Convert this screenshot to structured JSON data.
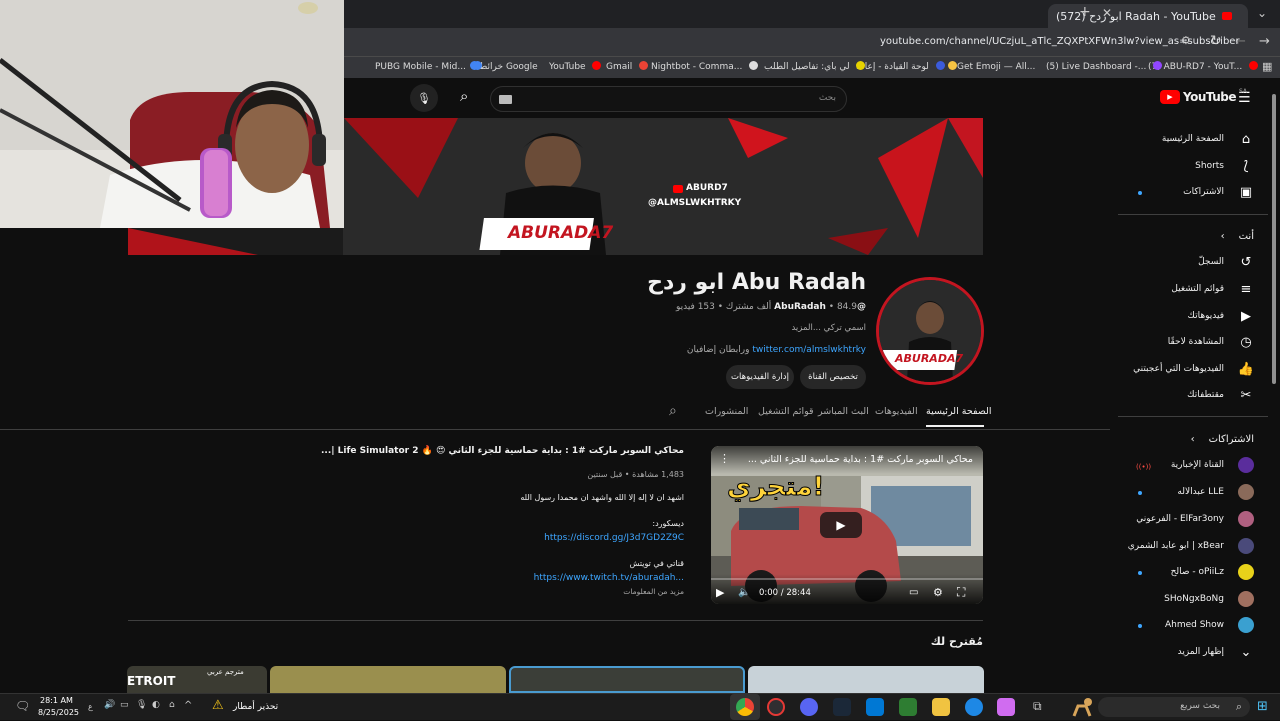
{
  "browser": {
    "tab_title": "(572) ابو ردح Radah - YouTube",
    "url": "youtube.com/channel/UCzjuL_aTlc_ZQXPtXFWn3lw?view_as=subscriber",
    "bookmarks": [
      {
        "label": "(7) ABU-RD7 - YouT...",
        "color": "#ff0000"
      },
      {
        "label": "(5) Live Dashboard -...",
        "color": "#9146ff"
      },
      {
        "label": "Get Emoji — All...",
        "color": "#f6c343"
      },
      {
        "label": "لوحة القيادة - إعادة",
        "color": "#3b5bdb"
      },
      {
        "label": "لي باي: تفاصيل الطلب",
        "color": "#e6d200"
      },
      {
        "label": "Nightbot - Comma...",
        "color": "#dddddd"
      },
      {
        "label": "Gmail",
        "color": "#ea4335"
      },
      {
        "label": "YouTube",
        "color": "#ff0000"
      },
      {
        "label": "خرائط Google",
        "color": "#34a853"
      },
      {
        "label": "PUBG Mobile - Mid...",
        "color": "#4285f4"
      }
    ]
  },
  "youtube": {
    "logo_text": "YouTube",
    "logo_region": "SA",
    "search_placeholder": "بحث"
  },
  "sidebar": {
    "main": [
      {
        "label": "الصفحة الرئيسية",
        "icon": "home-icon"
      },
      {
        "label": "Shorts",
        "icon": "shorts-icon"
      },
      {
        "label": "الاشتراكات",
        "icon": "subscriptions-icon"
      }
    ],
    "you_heading": "أنت",
    "you": [
      {
        "label": "السجلّ",
        "icon": "history-icon"
      },
      {
        "label": "قوائم التشغيل",
        "icon": "playlist-icon"
      },
      {
        "label": "فيديوهاتك",
        "icon": "your-videos-icon"
      },
      {
        "label": "المشاهدة لاحقًا",
        "icon": "watch-later-icon"
      },
      {
        "label": "الفيديوهات التي أعجبتني",
        "icon": "thumbs-up-icon"
      },
      {
        "label": "مقتطفاتك",
        "icon": "clips-icon"
      }
    ],
    "subs_heading": "الاشتراكات",
    "subs": [
      {
        "label": "القناة الإخبارية",
        "color": "#5a2d9c",
        "live": true
      },
      {
        "label": "LLE عبدالاله",
        "color": "#8a6a5a"
      },
      {
        "label": "ElFar3ony - الفرعوني",
        "color": "#b06080"
      },
      {
        "label": "xBear | ابو عابد الشمري",
        "color": "#4a4a7a"
      },
      {
        "label": "oPiiLz - صالح",
        "color": "#e8d21a"
      },
      {
        "label": "SHoNgxBoNg",
        "color": "#a07060"
      },
      {
        "label": "Ahmed Show",
        "color": "#3aa0d0"
      }
    ],
    "show_more": "إظهار المزيد"
  },
  "banner": {
    "handle_line1": "ABURD7",
    "handle_line2": "@ALMSLWKHTRKY",
    "logo": "ABURADA7"
  },
  "channel": {
    "name": "ابو ردح Abu Radah",
    "handle": "@AbuRadah",
    "stats": "84.9 ألف مشترك ‏• 153 فيديو",
    "about": "اسمي تركي ...المزيد",
    "link": "twitter.com/almslwkhtrky",
    "link_extra": "ورابطان إضافيان",
    "customize_button": "تخصيص القناة",
    "manage_button": "إدارة الفيديوهات",
    "avatar_text": "ABURADA7"
  },
  "tabs": [
    "الصفحة الرئيسية",
    "الفيديوهات",
    "البث المباشر",
    "قوائم التشغيل",
    "المنشورات"
  ],
  "featured": {
    "player_title": "محاكي السوبر ماركت #1 : بداية حماسية للجزء الثاني ...",
    "thumb_text": "متجري!",
    "time": "0:00 / 28:44",
    "title": "محاكي السوبر ماركت #1 : بداية حماسية للجزء الثاني 😍 🔥 Life Simulator 2 |...",
    "meta": "1,483 مشاهدة • قبل سنتين",
    "desc1": "اشهد ان لا إله إلا الله واشهد ان محمدا رسول الله",
    "desc2_label": "ديسكورد:",
    "desc2_link": "https://discord.gg/J3d7GD2Z9C",
    "desc3_label": "قناتي في تويتش",
    "desc3_link": "https://www.twitch.tv/aburadah...",
    "more": "مزيد من المعلومات"
  },
  "suggested_heading": "مُقترح لك",
  "suggested_thumb_text": "ETROIT",
  "suggested_thumb_text2": "مترجم عربي",
  "taskbar": {
    "search": "بحث سريع",
    "weather": "تحذير أمطار",
    "time": "28:1 AM",
    "date": "8/25/2025",
    "lang": "ع"
  }
}
